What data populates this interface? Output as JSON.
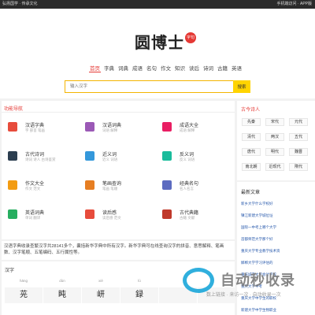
{
  "topbar": {
    "left": "弘扬国学 · 传承文化",
    "right": "手机端访问 · APP版"
  },
  "logo": {
    "text": "圆博士",
    "seal": "字句"
  },
  "nav": [
    "首页",
    "字典",
    "词典",
    "成语",
    "名句",
    "作文",
    "知识",
    "读后",
    "诗词",
    "古籍",
    "英语"
  ],
  "search": {
    "placeholder": "输入汉字",
    "button": "搜索"
  },
  "main": {
    "title": "功能导航",
    "items": [
      {
        "title": "汉语字典",
        "sub": "字 部首 笔画",
        "color": "#e74c3c"
      },
      {
        "title": "汉语词典",
        "sub": "词语 解释",
        "color": "#9b59b6"
      },
      {
        "title": "成语大全",
        "sub": "成语 解释",
        "color": "#e91e63"
      },
      {
        "title": "古代诗词",
        "sub": "诗词 诗人 古诗鉴赏",
        "color": "#2c3e50"
      },
      {
        "title": "近义词",
        "sub": "近义 词语",
        "color": "#3498db"
      },
      {
        "title": "反义词",
        "sub": "反义 词语",
        "color": "#1abc9c"
      },
      {
        "title": "作文大全",
        "sub": "作文 范文",
        "color": "#f39c12"
      },
      {
        "title": "笔画查询",
        "sub": "笔画 笔顺",
        "color": "#e67e22"
      },
      {
        "title": "经典名句",
        "sub": "名人名言",
        "color": "#5c6bc0"
      },
      {
        "title": "英语词典",
        "sub": "单词 翻译",
        "color": "#27ae60"
      },
      {
        "title": "读后感",
        "sub": "读后感 范文",
        "color": "#e74c3c"
      },
      {
        "title": "古代典籍",
        "sub": "古籍 文献",
        "color": "#c0392b"
      }
    ]
  },
  "desc": "汉语字典收录查繁汉字共28141多个，囊括新华字典中所有汉字。新华字典可在线查询汉字的拼音、意思解释、笔画数、汉字笔顺、五笔编码、五行属性等。",
  "hanzi": {
    "title": "汉字",
    "items": [
      {
        "py": "hāng",
        "hz": "茪"
      },
      {
        "py": "dùn",
        "hz": "盹"
      },
      {
        "py": "xiè",
        "hz": "岍"
      },
      {
        "py": "lù",
        "hz": "録"
      },
      {
        "py": "",
        "hz": ""
      },
      {
        "py": "",
        "hz": ""
      }
    ]
  },
  "side1": {
    "title": "古今诗人",
    "tags": [
      "先秦",
      "宋代",
      "元代",
      "清代",
      "两汉",
      "五代",
      "唐代",
      "明代",
      "魏晋",
      "南北朝",
      "近现代",
      "隋代"
    ]
  },
  "side2": {
    "title": "最新文章",
    "articles": [
      "新乡大学什么学校好",
      "镇江新建大学城位址",
      "国际一中考上哪个大学",
      "首都师范大学那个好",
      "重庆大学专业教学技术资",
      "邯郸大学学习评估的",
      "重庆城市大学会计学校",
      "重庆大学中考",
      "重庆大学中学生的职校",
      "新建大学中学生物职业"
    ]
  },
  "watermark": {
    "text": "自动秒收录",
    "sub": "数上链接 · 来访一次 · 自动收录一次"
  }
}
